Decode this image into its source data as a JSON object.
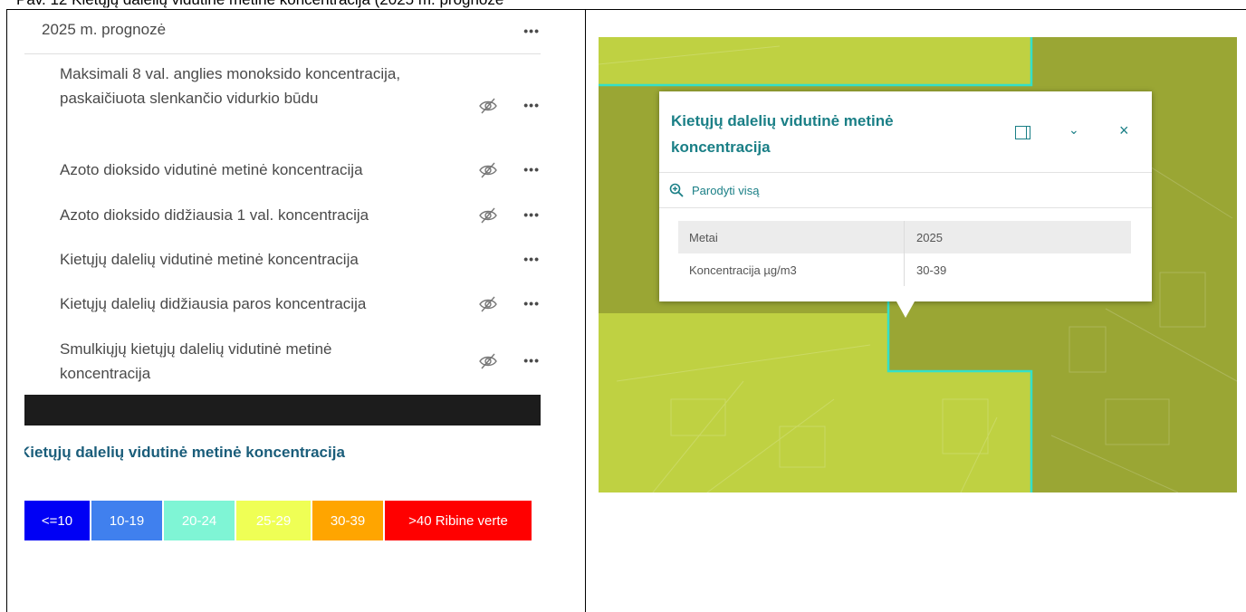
{
  "caption": "Pav. 12 Kietųjų dalelių vidutinė metinė koncentracija (2025 m. prognozė",
  "layer_panel": {
    "group_title": "2025 m. prognozė",
    "more_glyph": "•••",
    "items": [
      {
        "label": "Maksimali 8 val. anglies monoksido koncentracija, paskaičiuota slenkančio vidurkio būdu",
        "visible": false
      },
      {
        "label": "Azoto dioksido vidutinė metinė koncentracija",
        "visible": false
      },
      {
        "label": "Azoto dioksido didžiausia 1 val. koncentracija",
        "visible": false
      },
      {
        "label": "Kietųjų dalelių vidutinė metinė koncentracija",
        "visible": true
      },
      {
        "label": "Kietųjų dalelių didžiausia paros koncentracija",
        "visible": false
      },
      {
        "label": "Smulkiųjų kietųjų dalelių vidutinė metinė koncentracija",
        "visible": false
      }
    ]
  },
  "legend": {
    "title": "Kietųjų dalelių vidutinė metinė koncentracija",
    "classes": [
      {
        "label": "<=10",
        "color": "#0000f5"
      },
      {
        "label": "10-19",
        "color": "#4080ee"
      },
      {
        "label": "20-24",
        "color": "#7ff5d5"
      },
      {
        "label": "25-29",
        "color": "#efff55"
      },
      {
        "label": "30-39",
        "color": "#ffa500"
      },
      {
        "label": ">40 Ribine verte",
        "color": "#ff0000"
      }
    ]
  },
  "popup": {
    "title": "Kietųjų dalelių vidutinė metinė koncentracija",
    "zoom_label": "Parodyti visą",
    "close_glyph": "×",
    "chevron_glyph": "⌄",
    "attributes": [
      {
        "key": "Metai",
        "value": "2025"
      },
      {
        "key": "Koncentracija µg/m3",
        "value": "30-39"
      }
    ]
  },
  "map_colors": {
    "light": "#bfd142",
    "dark": "#9aa634",
    "boundary": "#33e0c8"
  }
}
